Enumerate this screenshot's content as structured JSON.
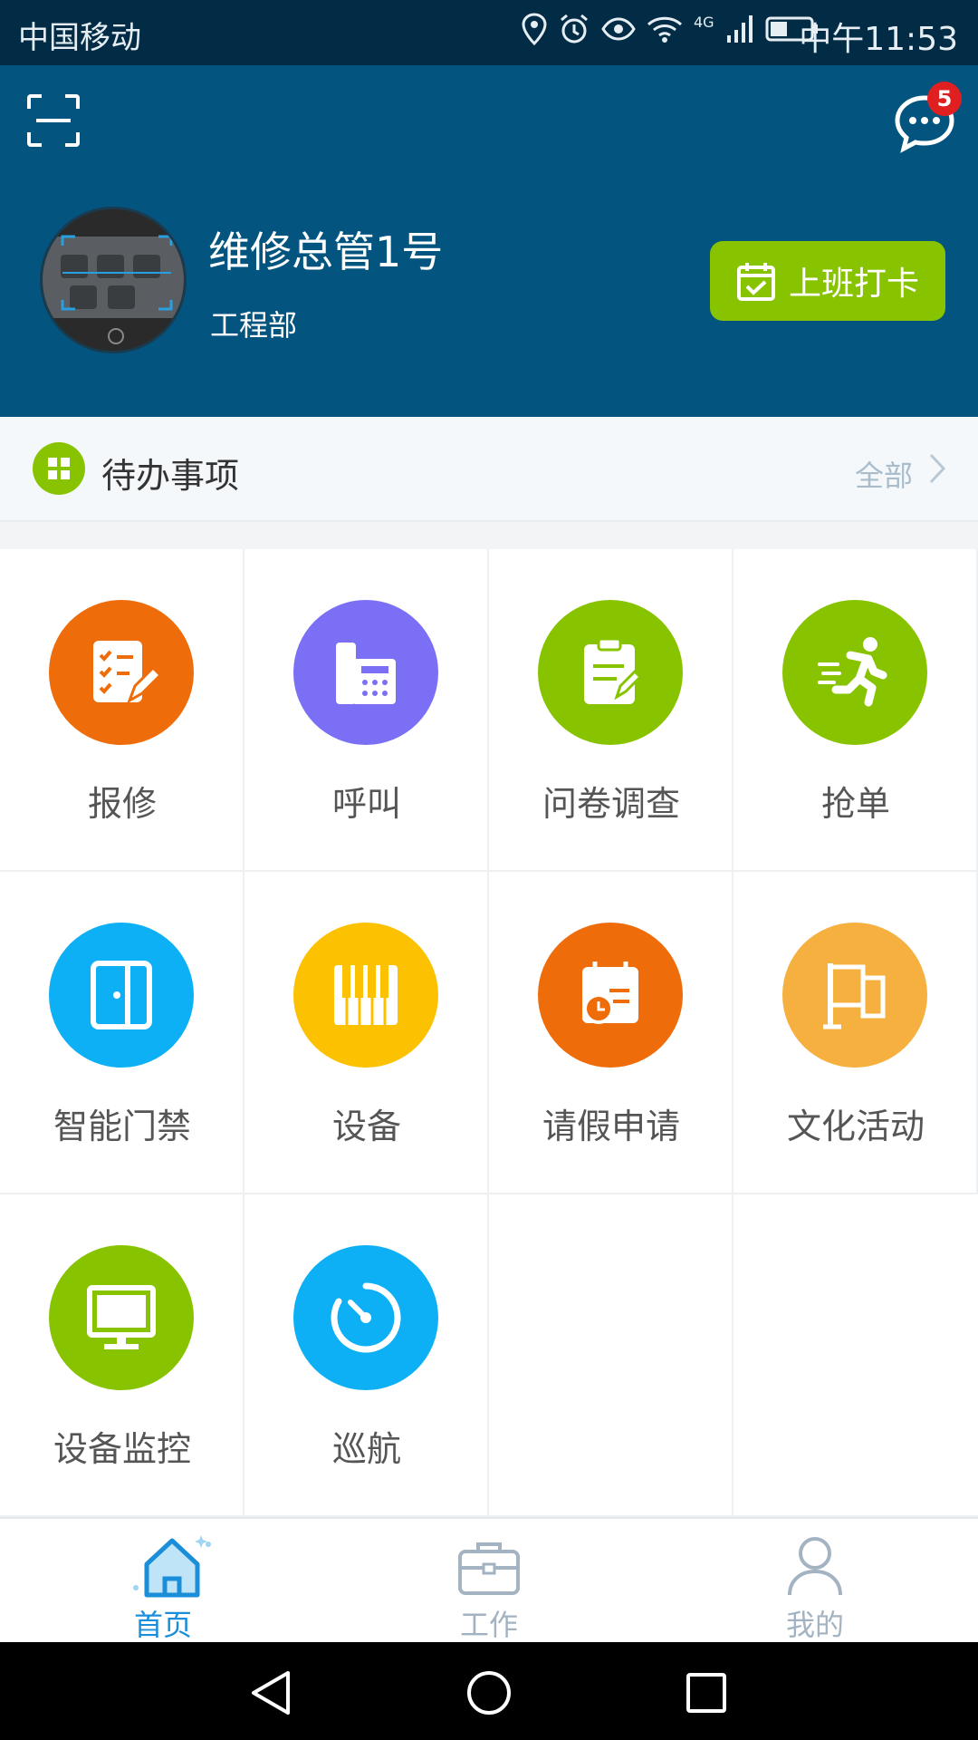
{
  "status_bar": {
    "carrier": "中国移动",
    "network": "4G",
    "time": "中午11:53"
  },
  "header": {
    "message_badge": "5",
    "user_name": "维修总管1号",
    "department": "工程部",
    "checkin_label": "上班打卡"
  },
  "todo": {
    "title": "待办事项",
    "all_label": "全部"
  },
  "grid": {
    "items": [
      {
        "label": "报修",
        "icon": "repair-checklist-icon",
        "color": "#ef6c0a"
      },
      {
        "label": "呼叫",
        "icon": "telephone-icon",
        "color": "#7b70f5"
      },
      {
        "label": "问卷调查",
        "icon": "clipboard-icon",
        "color": "#88c300"
      },
      {
        "label": "抢单",
        "icon": "running-man-icon",
        "color": "#88c300"
      },
      {
        "label": "智能门禁",
        "icon": "door-icon",
        "color": "#0db0f5"
      },
      {
        "label": "设备",
        "icon": "piano-keys-icon",
        "color": "#fcc100"
      },
      {
        "label": "请假申请",
        "icon": "calendar-clock-icon",
        "color": "#ef6c0a"
      },
      {
        "label": "文化活动",
        "icon": "flag-icon",
        "color": "#f5b040"
      },
      {
        "label": "设备监控",
        "icon": "monitor-icon",
        "color": "#88c300"
      },
      {
        "label": "巡航",
        "icon": "stopwatch-icon",
        "color": "#0db0f5"
      }
    ]
  },
  "tabbar": {
    "tabs": [
      {
        "label": "首页",
        "icon": "home-icon",
        "active": true
      },
      {
        "label": "工作",
        "icon": "briefcase-icon",
        "active": false
      },
      {
        "label": "我的",
        "icon": "person-icon",
        "active": false
      }
    ]
  }
}
